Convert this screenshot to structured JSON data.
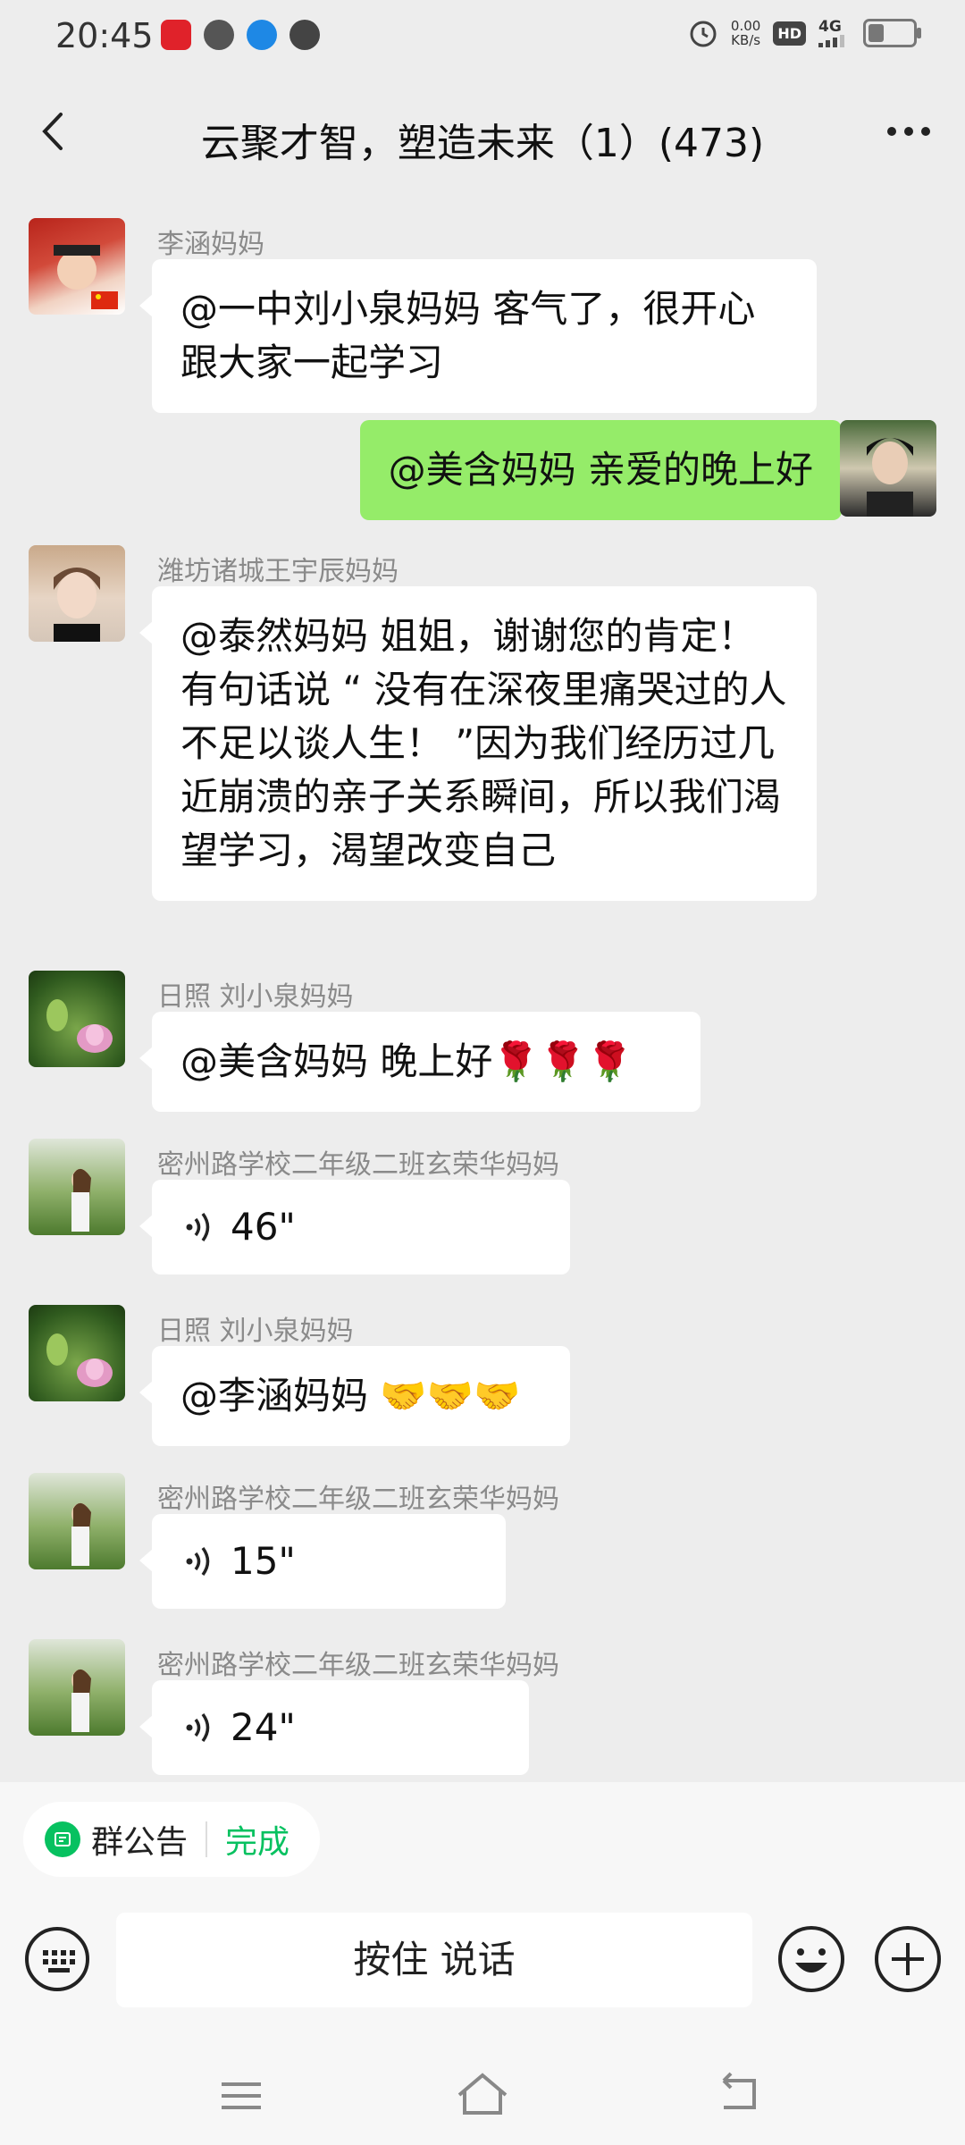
{
  "status_bar": {
    "time": "20:45",
    "net_speed_value": "0.00",
    "net_speed_unit": "KB/s",
    "hd": "HD",
    "network": "4G",
    "battery_level": 0.35,
    "left_icons": [
      "red-app-icon",
      "cat-app-icon",
      "browser-icon",
      "compass-icon"
    ]
  },
  "header": {
    "title": "云聚才智，塑造未来（1）(473)",
    "back_icon": "chevron-left-icon",
    "more_icon": "more-dots-icon"
  },
  "messages": [
    {
      "sender": "李涵妈妈",
      "text": "@一中刘小泉妈妈  客气了，很开心跟大家一起学习",
      "type": "text"
    },
    {
      "sender": "",
      "text": "@美含妈妈  亲爱的晚上好",
      "type": "text",
      "mine": true
    },
    {
      "sender": "潍坊诸城王宇辰妈妈",
      "text": "@泰然妈妈  姐姐，谢谢您的肯定！有句话说 “ 没有在深夜里痛哭过的人不足以谈人生！ ”因为我们经历过几近崩溃的亲子关系瞬间，所以我们渴望学习，渴望改变自己",
      "type": "text"
    },
    {
      "sender": "日照    刘小泉妈妈",
      "text": "@美含妈妈  晚上好🌹🌹🌹",
      "type": "text"
    },
    {
      "sender": "密州路学校二年级二班玄荣华妈妈",
      "text": "46\"",
      "type": "voice"
    },
    {
      "sender": "日照    刘小泉妈妈",
      "text": "@李涵妈妈  🤝🤝🤝",
      "type": "text"
    },
    {
      "sender": "密州路学校二年级二班玄荣华妈妈",
      "text": "15\"",
      "type": "voice"
    },
    {
      "sender": "密州路学校二年级二班玄荣华妈妈",
      "text": "24\"",
      "type": "voice"
    }
  ],
  "notice_chip": {
    "label": "群公告",
    "action": "完成",
    "icon": "notice-icon"
  },
  "input_bar": {
    "hold_to_talk": "按住  说话",
    "keyboard_icon": "keyboard-icon",
    "emoji_icon": "emoji-icon",
    "plus_icon": "plus-icon"
  },
  "nav_bar": {
    "icons": [
      "menu-icon",
      "home-icon",
      "back-icon"
    ]
  },
  "colors": {
    "background": "#ededed",
    "my_bubble": "#95ec69",
    "accent_green": "#07c160"
  }
}
